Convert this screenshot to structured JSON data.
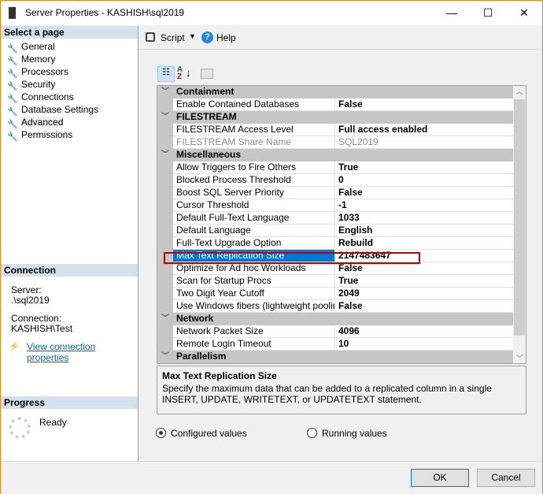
{
  "window": {
    "title": "Server Properties - KASHISH\\sql2019",
    "minimize": "—",
    "maximize": "☐",
    "close": "✕"
  },
  "left": {
    "select_header": "Select a page",
    "pages": [
      "General",
      "Memory",
      "Processors",
      "Security",
      "Connections",
      "Database Settings",
      "Advanced",
      "Permissions"
    ],
    "selected": "Advanced",
    "connection_header": "Connection",
    "server_label": "Server:",
    "server_value": ".\\sql2019",
    "connection_label": "Connection:",
    "connection_value": "KASHISH\\Test",
    "view_link": "View connection properties",
    "progress_header": "Progress",
    "progress_status": "Ready"
  },
  "toolbar": {
    "script": "Script",
    "help": "Help"
  },
  "grid": {
    "rows": [
      {
        "type": "cat",
        "name": "Containment"
      },
      {
        "name": "Enable Contained Databases",
        "value": "False"
      },
      {
        "type": "cat",
        "name": "FILESTREAM"
      },
      {
        "name": "FILESTREAM Access Level",
        "value": "Full access enabled"
      },
      {
        "name": "FILESTREAM Share Name",
        "value": "SQL2019",
        "disabled": true
      },
      {
        "type": "cat",
        "name": "Miscellaneous"
      },
      {
        "name": "Allow Triggers to Fire Others",
        "value": "True"
      },
      {
        "name": "Blocked Process Threshold",
        "value": "0"
      },
      {
        "name": "Boost SQL Server Priority",
        "value": "False"
      },
      {
        "name": "Cursor Threshold",
        "value": "-1"
      },
      {
        "name": "Default Full-Text Language",
        "value": "1033"
      },
      {
        "name": "Default Language",
        "value": "English"
      },
      {
        "name": "Full-Text Upgrade Option",
        "value": "Rebuild"
      },
      {
        "name": "Max Text Replication Size",
        "value": "2147483647",
        "selected": true
      },
      {
        "name": "Optimize for Ad hoc Workloads",
        "value": "False"
      },
      {
        "name": "Scan for Startup Procs",
        "value": "True"
      },
      {
        "name": "Two Digit Year Cutoff",
        "value": "2049"
      },
      {
        "name": "Use Windows fibers (lightweight pooling)",
        "value": "False"
      },
      {
        "type": "cat",
        "name": "Network"
      },
      {
        "name": "Network Packet Size",
        "value": "4096"
      },
      {
        "name": "Remote Login Timeout",
        "value": "10"
      },
      {
        "type": "cat",
        "name": "Parallelism"
      }
    ]
  },
  "description": {
    "title": "Max Text Replication Size",
    "text": "Specify the maximum data that can be added to a replicated column in a single INSERT, UPDATE, WRITETEXT, or UPDATETEXT statement."
  },
  "options": {
    "configured": "Configured values",
    "running": "Running values",
    "selected": "configured"
  },
  "buttons": {
    "ok": "OK",
    "cancel": "Cancel"
  },
  "colors": {
    "selection": "#0078d7",
    "highlight_box": "#c00000",
    "window_border": "#e38a1c"
  }
}
